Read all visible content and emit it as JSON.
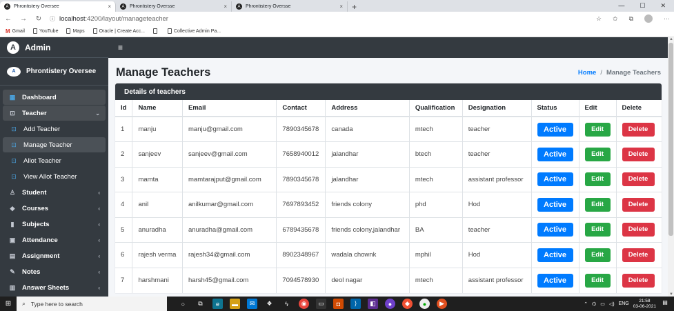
{
  "browser": {
    "tabs": [
      {
        "title": "Phrontistery Oversee",
        "close": "×",
        "active": true
      },
      {
        "title": "Phrontistery Oversse",
        "close": "×",
        "active": false
      },
      {
        "title": "Phrontistery Oversse",
        "close": "×",
        "active": false
      }
    ],
    "new_tab": "+",
    "window_controls": {
      "minimize": "—",
      "maximize": "☐",
      "close": "✕"
    },
    "url_host": "localhost",
    "url_path": ":4200/layout/manageteacher",
    "bookmarks": [
      "Gmail",
      "YouTube",
      "Maps",
      "Oracle | Create Acc...",
      "",
      "Collective Admin Pa..."
    ]
  },
  "sidebar": {
    "brand_logo": "A",
    "brand": "Admin",
    "user_logo": "A",
    "user": "Phrontistery Oversee",
    "items": [
      {
        "label": "Dashboard",
        "icon": "grid-icon",
        "glyph": "▦",
        "type": "top",
        "chevron": ""
      },
      {
        "label": "Teacher",
        "icon": "teacher-icon",
        "glyph": "⊡",
        "type": "open",
        "chevron": "⌄"
      },
      {
        "label": "Add Teacher",
        "icon": "teacher-icon",
        "glyph": "⊡",
        "type": "sub",
        "chevron": ""
      },
      {
        "label": "Manage Teacher",
        "icon": "teacher-icon",
        "glyph": "⊡",
        "type": "sub current",
        "chevron": ""
      },
      {
        "label": "Allot Teacher",
        "icon": "teacher-icon",
        "glyph": "⊡",
        "type": "sub",
        "chevron": ""
      },
      {
        "label": "View Allot Teacher",
        "icon": "teacher-icon",
        "glyph": "⊡",
        "type": "sub",
        "chevron": ""
      },
      {
        "label": "Student",
        "icon": "student-icon",
        "glyph": "♙",
        "type": "top",
        "chevron": "‹"
      },
      {
        "label": "Courses",
        "icon": "graduation-cap-icon",
        "glyph": "◆",
        "type": "top",
        "chevron": "‹"
      },
      {
        "label": "Subjects",
        "icon": "book-icon",
        "glyph": "▮",
        "type": "top",
        "chevron": "‹"
      },
      {
        "label": "Attendance",
        "icon": "calendar-icon",
        "glyph": "▣",
        "type": "top",
        "chevron": "‹"
      },
      {
        "label": "Assignment",
        "icon": "clipboard-icon",
        "glyph": "▤",
        "type": "top",
        "chevron": "‹"
      },
      {
        "label": "Notes",
        "icon": "edit-icon",
        "glyph": "✎",
        "type": "top",
        "chevron": "‹"
      },
      {
        "label": "Answer Sheets",
        "icon": "document-icon",
        "glyph": "▥",
        "type": "top",
        "chevron": "‹"
      }
    ]
  },
  "topnav": {
    "menu_glyph": "≡"
  },
  "page": {
    "title": "Manage Teachers",
    "breadcrumb_home": "Home",
    "breadcrumb_sep": "/",
    "breadcrumb_current": "Manage Teachers",
    "card_title": "Details of teachers"
  },
  "table": {
    "headers": [
      "Id",
      "Name",
      "Email",
      "Contact",
      "Address",
      "Qualification",
      "Designation",
      "Status",
      "Edit",
      "Delete"
    ],
    "rows": [
      {
        "id": "1",
        "name": "manju",
        "email": "manju@gmail.com",
        "contact": "7890345678",
        "address": "canada",
        "qualification": "mtech",
        "designation": "teacher",
        "status": "Active",
        "edit": "Edit",
        "delete": "Delete"
      },
      {
        "id": "2",
        "name": "sanjeev",
        "email": "sanjeev@gmail.com",
        "contact": "7658940012",
        "address": "jalandhar",
        "qualification": "btech",
        "designation": "teacher",
        "status": "Active",
        "edit": "Edit",
        "delete": "Delete"
      },
      {
        "id": "3",
        "name": "mamta",
        "email": "mamtarajput@gmail.com",
        "contact": "7890345678",
        "address": "jalandhar",
        "qualification": "mtech",
        "designation": "assistant professor",
        "status": "Active",
        "edit": "Edit",
        "delete": "Delete"
      },
      {
        "id": "4",
        "name": "anil",
        "email": "anilkumar@gmail.com",
        "contact": "7697893452",
        "address": "friends colony",
        "qualification": "phd",
        "designation": "Hod",
        "status": "Active",
        "edit": "Edit",
        "delete": "Delete"
      },
      {
        "id": "5",
        "name": "anuradha",
        "email": "anuradha@gmail.com",
        "contact": "6789435678",
        "address": "friends colony,jalandhar",
        "qualification": "BA",
        "designation": "teacher",
        "status": "Active",
        "edit": "Edit",
        "delete": "Delete"
      },
      {
        "id": "6",
        "name": "rajesh verma",
        "email": "rajesh34@gmail.com",
        "contact": "8902348967",
        "address": "wadala chownk",
        "qualification": "mphil",
        "designation": "Hod",
        "status": "Active",
        "edit": "Edit",
        "delete": "Delete"
      },
      {
        "id": "7",
        "name": "harshmani",
        "email": "harsh45@gmail.com",
        "contact": "7094578930",
        "address": "deol nagar",
        "qualification": "mtech",
        "designation": "assistant professor",
        "status": "Active",
        "edit": "Edit",
        "delete": "Delete"
      }
    ]
  },
  "taskbar": {
    "search_placeholder": "Type here to search",
    "language": "ENG",
    "time": "21:58",
    "date": "03-06-2021"
  },
  "colors": {
    "primary": "#007bff",
    "success": "#28a745",
    "danger": "#dc3545",
    "dark": "#343a40"
  }
}
